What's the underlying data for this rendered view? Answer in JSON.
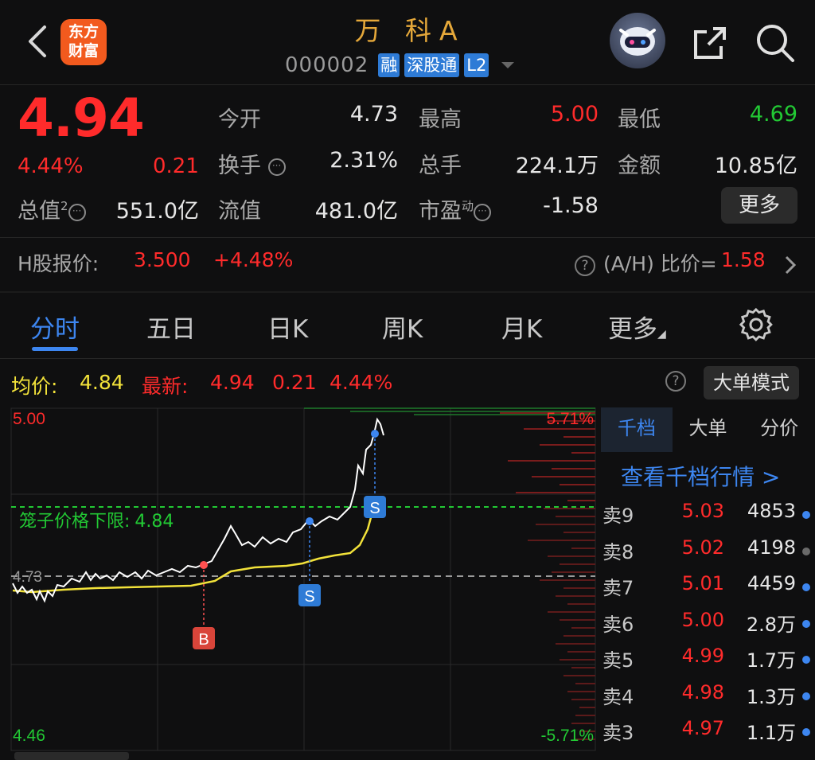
{
  "header": {
    "logo_text_1": "东方",
    "logo_text_2": "财富",
    "stock_name": "万 科A",
    "stock_code": "000002",
    "tags": [
      "融",
      "深股通",
      "L2"
    ]
  },
  "quote": {
    "price": "4.94",
    "change_pct": "4.44%",
    "change_val": "0.21",
    "fields": {
      "open_label": "今开",
      "open": "4.73",
      "high_label": "最高",
      "high": "5.00",
      "low_label": "最低",
      "low": "4.69",
      "turnover_label": "换手",
      "turnover": "2.31%",
      "volume_label": "总手",
      "volume": "224.1万",
      "amount_label": "金额",
      "amount": "10.85亿",
      "mktcap_label": "总值",
      "mktcap_sup": "2",
      "mktcap": "551.0亿",
      "float_label": "流值",
      "float": "481.0亿",
      "pe_label": "市盈",
      "pe_sup": "动",
      "pe": "-1.58"
    },
    "more_label": "更多"
  },
  "h_share": {
    "label": "H股报价:",
    "price": "3.500",
    "change": "+4.48%",
    "ratio_label": "(A/H) 比价=",
    "ratio": "1.58"
  },
  "tabs": [
    "分时",
    "五日",
    "日K",
    "周K",
    "月K",
    "更多"
  ],
  "info": {
    "avg_label": "均价:",
    "avg": "4.84",
    "latest_label": "最新:",
    "latest": "4.94",
    "latest_chg": "0.21",
    "latest_pct": "4.44%",
    "mode_label": "大单模式"
  },
  "chart": {
    "y_top": "5.00",
    "y_prev": "4.73",
    "y_bottom": "4.46",
    "pct_top": "5.71%",
    "pct_bottom": "-5.71%",
    "cage_label": "笼子价格下限:",
    "cage_value": "4.84",
    "markers": [
      "B",
      "S",
      "S"
    ],
    "colors": {
      "price_line": "#ffffff",
      "avg_line": "#f2e23a",
      "up": "#ff2b2b",
      "down": "#22c934",
      "accent": "#3d86f0"
    }
  },
  "order_book": {
    "tabs": [
      "千档",
      "大单",
      "分价"
    ],
    "link": "查看千档行情 >",
    "rows": [
      {
        "label": "卖9",
        "price": "5.03",
        "vol": "4853",
        "dot": "blue"
      },
      {
        "label": "卖8",
        "price": "5.02",
        "vol": "4198",
        "dot": "grey"
      },
      {
        "label": "卖7",
        "price": "5.01",
        "vol": "4459",
        "dot": "blue"
      },
      {
        "label": "卖6",
        "price": "5.00",
        "vol": "2.8万",
        "dot": "blue"
      },
      {
        "label": "卖5",
        "price": "4.99",
        "vol": "1.7万",
        "dot": "blue"
      },
      {
        "label": "卖4",
        "price": "4.98",
        "vol": "1.3万",
        "dot": "blue"
      },
      {
        "label": "卖3",
        "price": "4.97",
        "vol": "1.1万",
        "dot": "blue"
      }
    ]
  }
}
